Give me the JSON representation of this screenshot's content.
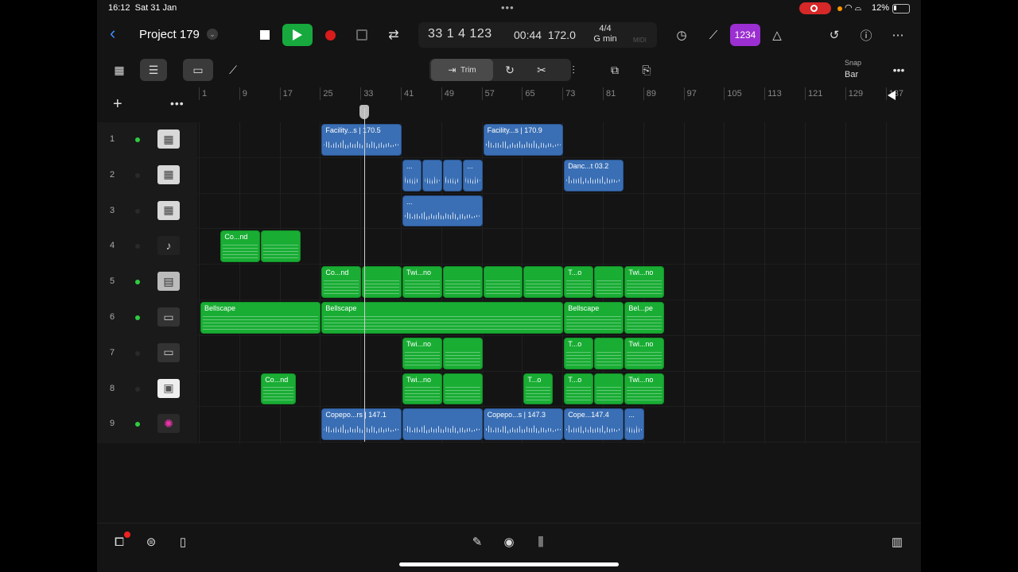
{
  "status": {
    "time": "16:12",
    "date": "Sat 31 Jan",
    "battery": "12%"
  },
  "header": {
    "project_title": "Project 179",
    "lcd": {
      "position": "33 1 4 123",
      "time": "00:44",
      "tempo": "172.0",
      "time_sig": "4/4",
      "key": "G min",
      "midi": "MIDI"
    },
    "count_in_label": "1234"
  },
  "toolbar": {
    "trim_label": "Trim",
    "snap_label": "Snap",
    "snap_value": "Bar"
  },
  "ruler": {
    "bars": [
      "1",
      "9",
      "17",
      "25",
      "33",
      "41",
      "49",
      "57",
      "65",
      "73",
      "81",
      "89",
      "97",
      "105",
      "113",
      "121",
      "129",
      "137"
    ]
  },
  "tracks": [
    {
      "num": "1",
      "active": true,
      "icon": "drum-machine-icon"
    },
    {
      "num": "2",
      "active": false,
      "icon": "drum-machine-icon"
    },
    {
      "num": "3",
      "active": false,
      "icon": "drum-machine-icon"
    },
    {
      "num": "4",
      "active": false,
      "icon": "grand-piano-icon"
    },
    {
      "num": "5",
      "active": true,
      "icon": "electric-piano-icon"
    },
    {
      "num": "6",
      "active": true,
      "icon": "synth-keyboard-icon"
    },
    {
      "num": "7",
      "active": false,
      "icon": "synth-keyboard-icon"
    },
    {
      "num": "8",
      "active": false,
      "icon": "sampler-icon"
    },
    {
      "num": "9",
      "active": true,
      "icon": "fx-sparkle-icon"
    }
  ],
  "regions": [
    {
      "track": 0,
      "start": 25,
      "end": 41,
      "kind": "audio",
      "name": "Facility...s | 170.5"
    },
    {
      "track": 0,
      "start": 57,
      "end": 73,
      "kind": "audio",
      "name": "Facility...s | 170.9"
    },
    {
      "track": 1,
      "start": 41,
      "end": 45,
      "kind": "audio",
      "name": "..."
    },
    {
      "track": 1,
      "start": 45,
      "end": 49,
      "kind": "audio",
      "name": ""
    },
    {
      "track": 1,
      "start": 49,
      "end": 53,
      "kind": "audio",
      "name": ""
    },
    {
      "track": 1,
      "start": 53,
      "end": 57,
      "kind": "audio",
      "name": "..."
    },
    {
      "track": 1,
      "start": 73,
      "end": 85,
      "kind": "audio",
      "name": "Danc...t 03.2"
    },
    {
      "track": 2,
      "start": 41,
      "end": 57,
      "kind": "audio",
      "name": "..."
    },
    {
      "track": 3,
      "start": 5,
      "end": 13,
      "kind": "midi",
      "name": "Co...nd"
    },
    {
      "track": 3,
      "start": 13,
      "end": 21,
      "kind": "midi",
      "name": ""
    },
    {
      "track": 4,
      "start": 25,
      "end": 33,
      "kind": "midi",
      "name": "Co...nd"
    },
    {
      "track": 4,
      "start": 33,
      "end": 41,
      "kind": "midi",
      "name": ""
    },
    {
      "track": 4,
      "start": 41,
      "end": 49,
      "kind": "midi",
      "name": "Twi...no"
    },
    {
      "track": 4,
      "start": 49,
      "end": 57,
      "kind": "midi",
      "name": ""
    },
    {
      "track": 4,
      "start": 57,
      "end": 65,
      "kind": "midi",
      "name": ""
    },
    {
      "track": 4,
      "start": 65,
      "end": 73,
      "kind": "midi",
      "name": ""
    },
    {
      "track": 4,
      "start": 73,
      "end": 79,
      "kind": "midi",
      "name": "T...o"
    },
    {
      "track": 4,
      "start": 79,
      "end": 85,
      "kind": "midi",
      "name": ""
    },
    {
      "track": 4,
      "start": 85,
      "end": 93,
      "kind": "midi",
      "name": "Twi...no"
    },
    {
      "track": 5,
      "start": 1,
      "end": 25,
      "kind": "midi",
      "name": "Bellscape"
    },
    {
      "track": 5,
      "start": 25,
      "end": 73,
      "kind": "midi",
      "name": "Bellscape"
    },
    {
      "track": 5,
      "start": 73,
      "end": 85,
      "kind": "midi",
      "name": "Bellscape"
    },
    {
      "track": 5,
      "start": 85,
      "end": 93,
      "kind": "midi",
      "name": "Bel...pe"
    },
    {
      "track": 6,
      "start": 41,
      "end": 49,
      "kind": "midi",
      "name": "Twi...no"
    },
    {
      "track": 6,
      "start": 49,
      "end": 57,
      "kind": "midi",
      "name": ""
    },
    {
      "track": 6,
      "start": 73,
      "end": 79,
      "kind": "midi",
      "name": "T...o"
    },
    {
      "track": 6,
      "start": 79,
      "end": 85,
      "kind": "midi",
      "name": ""
    },
    {
      "track": 6,
      "start": 85,
      "end": 93,
      "kind": "midi",
      "name": "Twi...no"
    },
    {
      "track": 7,
      "start": 13,
      "end": 20,
      "kind": "midi",
      "name": "Co...nd"
    },
    {
      "track": 7,
      "start": 41,
      "end": 49,
      "kind": "midi",
      "name": "Twi...no"
    },
    {
      "track": 7,
      "start": 49,
      "end": 57,
      "kind": "midi",
      "name": ""
    },
    {
      "track": 7,
      "start": 65,
      "end": 71,
      "kind": "midi",
      "name": "T...o"
    },
    {
      "track": 7,
      "start": 73,
      "end": 79,
      "kind": "midi",
      "name": "T...o"
    },
    {
      "track": 7,
      "start": 79,
      "end": 85,
      "kind": "midi",
      "name": ""
    },
    {
      "track": 7,
      "start": 85,
      "end": 93,
      "kind": "midi",
      "name": "Twi...no"
    },
    {
      "track": 8,
      "start": 25,
      "end": 41,
      "kind": "audio",
      "name": "Copepo...rs | 147.1"
    },
    {
      "track": 8,
      "start": 41,
      "end": 57,
      "kind": "audio",
      "name": ""
    },
    {
      "track": 8,
      "start": 57,
      "end": 73,
      "kind": "audio",
      "name": "Copepo...s | 147.3"
    },
    {
      "track": 8,
      "start": 73,
      "end": 85,
      "kind": "audio",
      "name": "Cope...147.4"
    },
    {
      "track": 8,
      "start": 85,
      "end": 89,
      "kind": "audio",
      "name": "..."
    }
  ],
  "playhead_bar": 33.4,
  "colors": {
    "audio": "#3a6fb5",
    "midi": "#19ad34",
    "play": "#17a93d",
    "record": "#d81b1b",
    "count_in": "#9b2fd1",
    "accent": "#3d8cff"
  }
}
